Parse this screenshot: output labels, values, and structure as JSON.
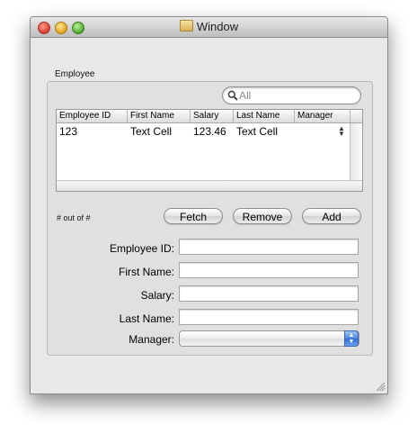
{
  "window": {
    "title": "Window"
  },
  "box": {
    "label": "Employee"
  },
  "search": {
    "placeholder": "All"
  },
  "table": {
    "columns": [
      "Employee ID",
      "First Name",
      "Salary",
      "Last Name",
      "Manager"
    ],
    "rows": [
      [
        "123",
        "Text Cell",
        "123.46",
        "Text Cell",
        ""
      ]
    ]
  },
  "count_text": "# out of #",
  "buttons": {
    "fetch": "Fetch",
    "remove": "Remove",
    "add": "Add"
  },
  "form": {
    "employee_id_label": "Employee ID:",
    "first_name_label": "First Name:",
    "salary_label": "Salary:",
    "last_name_label": "Last Name:",
    "manager_label": "Manager:",
    "employee_id_value": "",
    "first_name_value": "",
    "salary_value": "",
    "last_name_value": "",
    "manager_value": ""
  },
  "colors": {
    "window_bg": "#e8e8e8",
    "popup_accent": "#4c86e0"
  },
  "icons": [
    "search-icon",
    "window-title-icon",
    "resize-grip-icon",
    "sort-stepper-icon",
    "popup-arrows-icon"
  ]
}
